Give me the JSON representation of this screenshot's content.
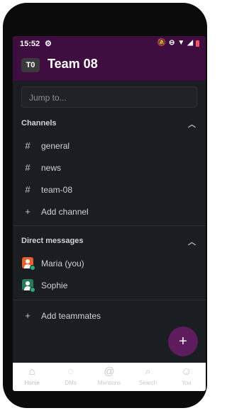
{
  "status_bar": {
    "time": "15:52",
    "gear_icon": "gear-icon",
    "icons": [
      "notifications-off-icon",
      "do-not-disturb-icon",
      "wifi-icon",
      "signal-icon",
      "battery-icon"
    ]
  },
  "header": {
    "team_initials": "T0",
    "team_name": "Team 08"
  },
  "search": {
    "placeholder": "Jump to..."
  },
  "channels": {
    "title": "Channels",
    "items": [
      {
        "label": "general"
      },
      {
        "label": "news"
      },
      {
        "label": "team-08"
      }
    ],
    "add_label": "Add channel"
  },
  "direct_messages": {
    "title": "Direct messages",
    "items": [
      {
        "label": "Maria (you)",
        "avatar_color": "#e8612d"
      },
      {
        "label": "Sophie",
        "avatar_color": "#2a7a5d"
      }
    ]
  },
  "add_teammates_label": "Add teammates",
  "fab": {
    "label": "+"
  },
  "tabs": [
    {
      "label": "Home",
      "icon": "home-icon"
    },
    {
      "label": "DMs",
      "icon": "dms-icon"
    },
    {
      "label": "Mentions",
      "icon": "mentions-icon"
    },
    {
      "label": "Search",
      "icon": "search-icon"
    },
    {
      "label": "You",
      "icon": "you-icon"
    }
  ],
  "colors": {
    "brand_aubergine": "#3f0e40",
    "sidebar_bg": "#1a1d21",
    "fab_bg": "#5e1c5e",
    "presence_active": "#2bac76"
  }
}
